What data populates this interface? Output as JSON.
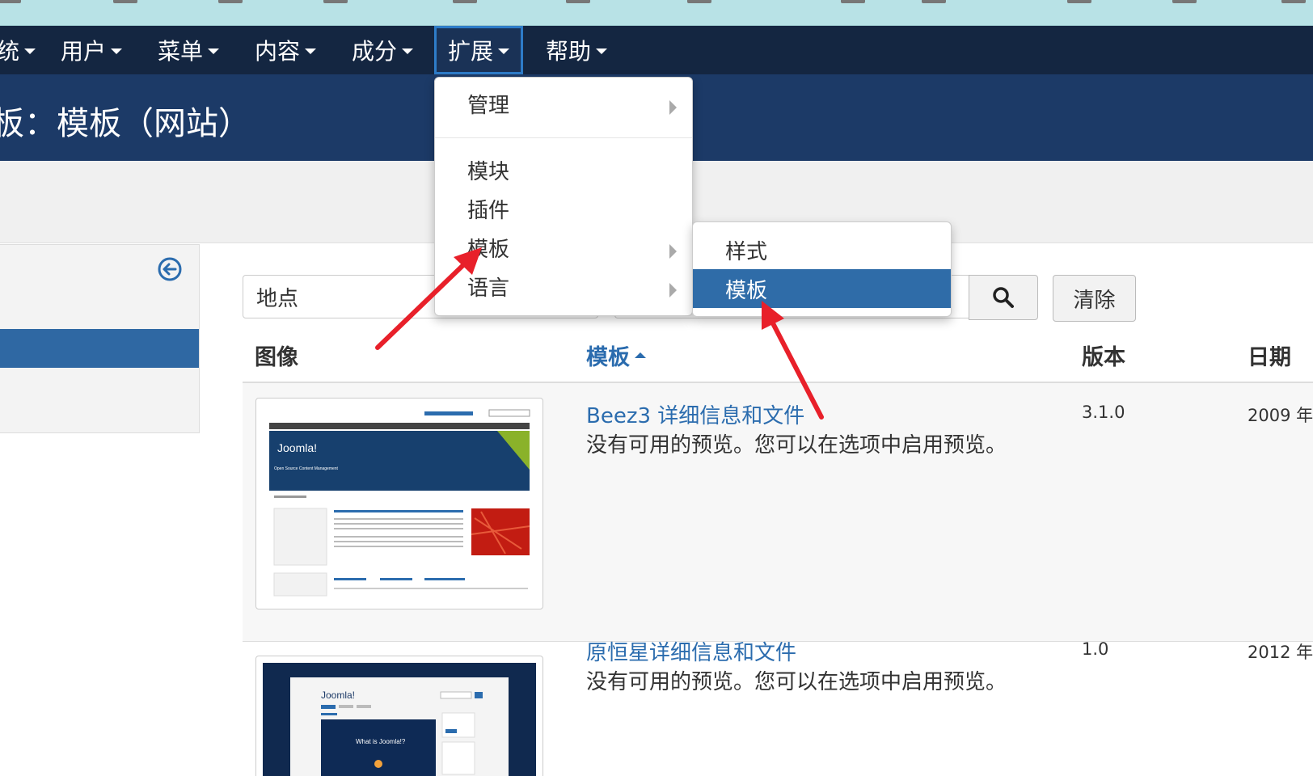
{
  "nav": {
    "items": [
      {
        "label": "统"
      },
      {
        "label": "用户"
      },
      {
        "label": "菜单"
      },
      {
        "label": "内容"
      },
      {
        "label": "成分"
      },
      {
        "label": "扩展"
      },
      {
        "label": "帮助"
      }
    ]
  },
  "page": {
    "title": "板：模板（网站）"
  },
  "dropdown": {
    "items": [
      {
        "label": "管理"
      },
      {
        "label": "模块"
      },
      {
        "label": "插件"
      },
      {
        "label": "模板"
      },
      {
        "label": "语言"
      }
    ]
  },
  "submenu": {
    "items": [
      {
        "label": "样式"
      },
      {
        "label": "模板"
      }
    ]
  },
  "filters": {
    "location": "地点",
    "clear_label": "清除"
  },
  "table": {
    "headers": {
      "image": "图像",
      "template": "模板",
      "version": "版本",
      "date": "日期"
    },
    "rows": [
      {
        "title": "Beez3 详细信息和文件",
        "description": "没有可用的预览。您可以在选项中启用预览。",
        "version": "3.1.0",
        "date": "2009 年",
        "thumb_brand": "Joomla!",
        "thumb_tagline": "Open Source Content Management"
      },
      {
        "title": "原恒星详细信息和文件",
        "description": "没有可用的预览。您可以在选项中启用预览。",
        "version": "1.0",
        "date": "2012 年",
        "thumb_brand": "Joomla!",
        "thumb_tagline": "What is Joomla!?"
      }
    ]
  },
  "colors": {
    "nav_bg": "#142641",
    "header_bg": "#1c3a67",
    "accent": "#2f6ca8",
    "link": "#2b6cae",
    "annotation_arrow": "#e8202a"
  }
}
